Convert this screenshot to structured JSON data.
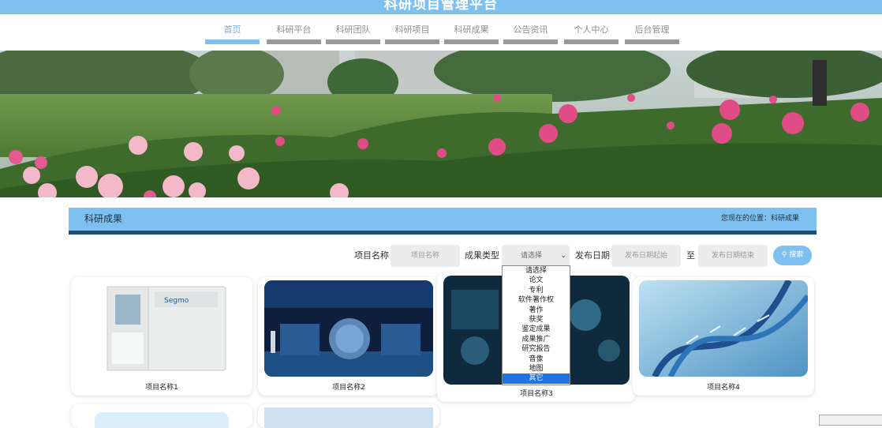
{
  "header": {
    "title": "科研项目管理平台"
  },
  "nav": {
    "items": [
      {
        "label": "首页",
        "active": true
      },
      {
        "label": "科研平台"
      },
      {
        "label": "科研团队"
      },
      {
        "label": "科研项目"
      },
      {
        "label": "科研成果"
      },
      {
        "label": "公告资讯"
      },
      {
        "label": "个人中心"
      },
      {
        "label": "后台管理"
      }
    ]
  },
  "section": {
    "title": "科研成果",
    "location": "您现在的位置：科研成果"
  },
  "filters": {
    "project_name_label": "项目名称",
    "project_name_placeholder": "项目名称",
    "type_label": "成果类型",
    "type_selected": "请选择",
    "date_label": "发布日期",
    "date_start_placeholder": "发布日期起始",
    "to_label": "至",
    "date_end_placeholder": "发布日期结束",
    "search_label": "搜索"
  },
  "type_options": [
    "请选择",
    "论文",
    "专利",
    "软件著作权",
    "著作",
    "获奖",
    "鉴定成果",
    "成果推广",
    "研究报告",
    "音像",
    "地图",
    "其它"
  ],
  "type_options_highlighted": "其它",
  "cards": [
    {
      "name": "项目名称1"
    },
    {
      "name": "项目名称2"
    },
    {
      "name": "项目名称3"
    },
    {
      "name": "项目名称4"
    }
  ],
  "colors": {
    "accent": "#7ec1f0",
    "dark": "#1f4e79",
    "selected": "#1e73e6"
  }
}
